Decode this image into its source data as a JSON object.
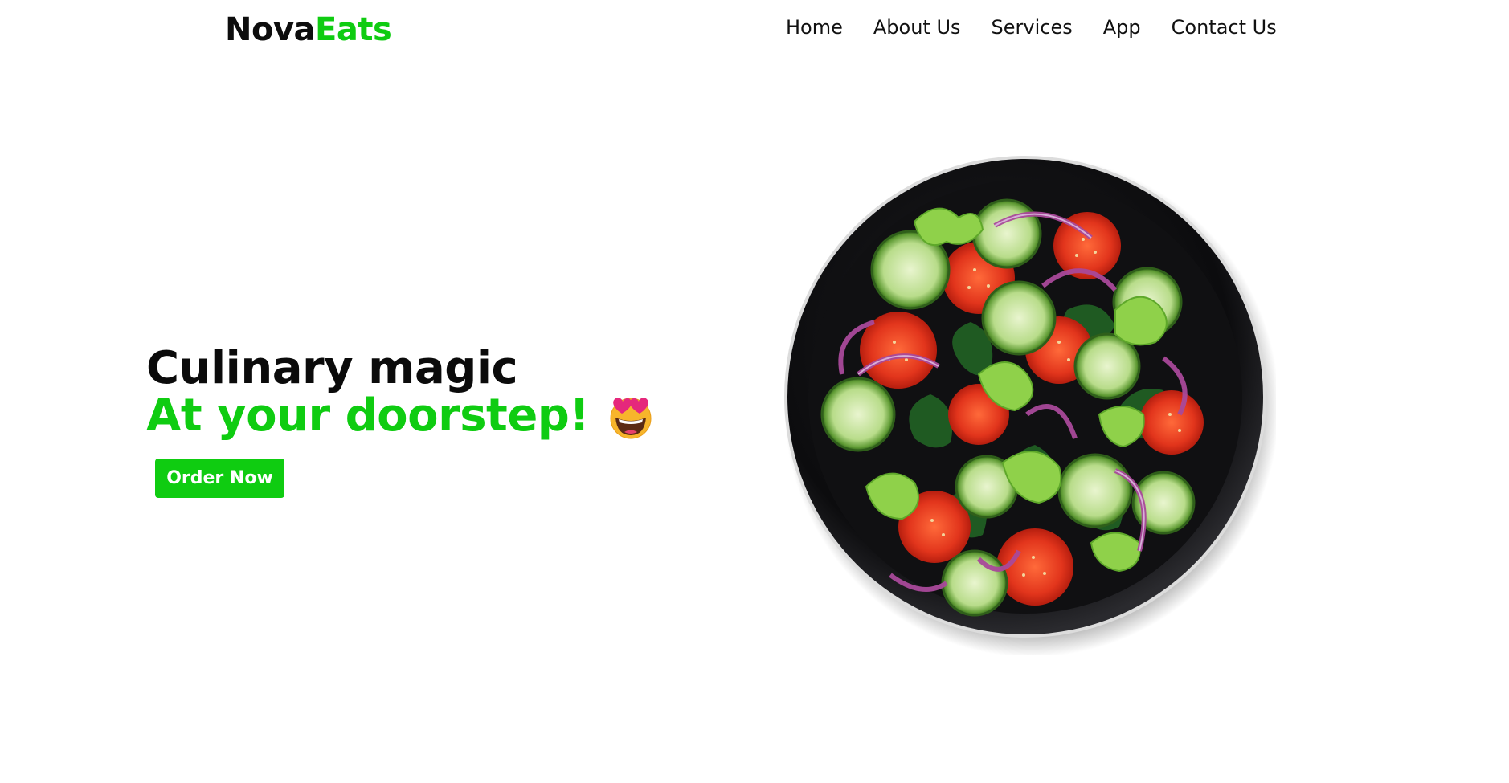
{
  "brand": {
    "part1": "Nova",
    "part2": "Eats"
  },
  "nav": {
    "items": [
      {
        "label": "Home"
      },
      {
        "label": "About Us"
      },
      {
        "label": "Services"
      },
      {
        "label": "App"
      },
      {
        "label": "Contact Us"
      }
    ]
  },
  "hero": {
    "line1": "Culinary magic",
    "line2": "At your doorstep!",
    "emoji": "smiling-face-with-heart-eyes",
    "cta_label": "Order Now",
    "image": "salad-bowl-plate"
  },
  "colors": {
    "accent": "#0fcc11",
    "text": "#111111",
    "background": "#ffffff"
  }
}
